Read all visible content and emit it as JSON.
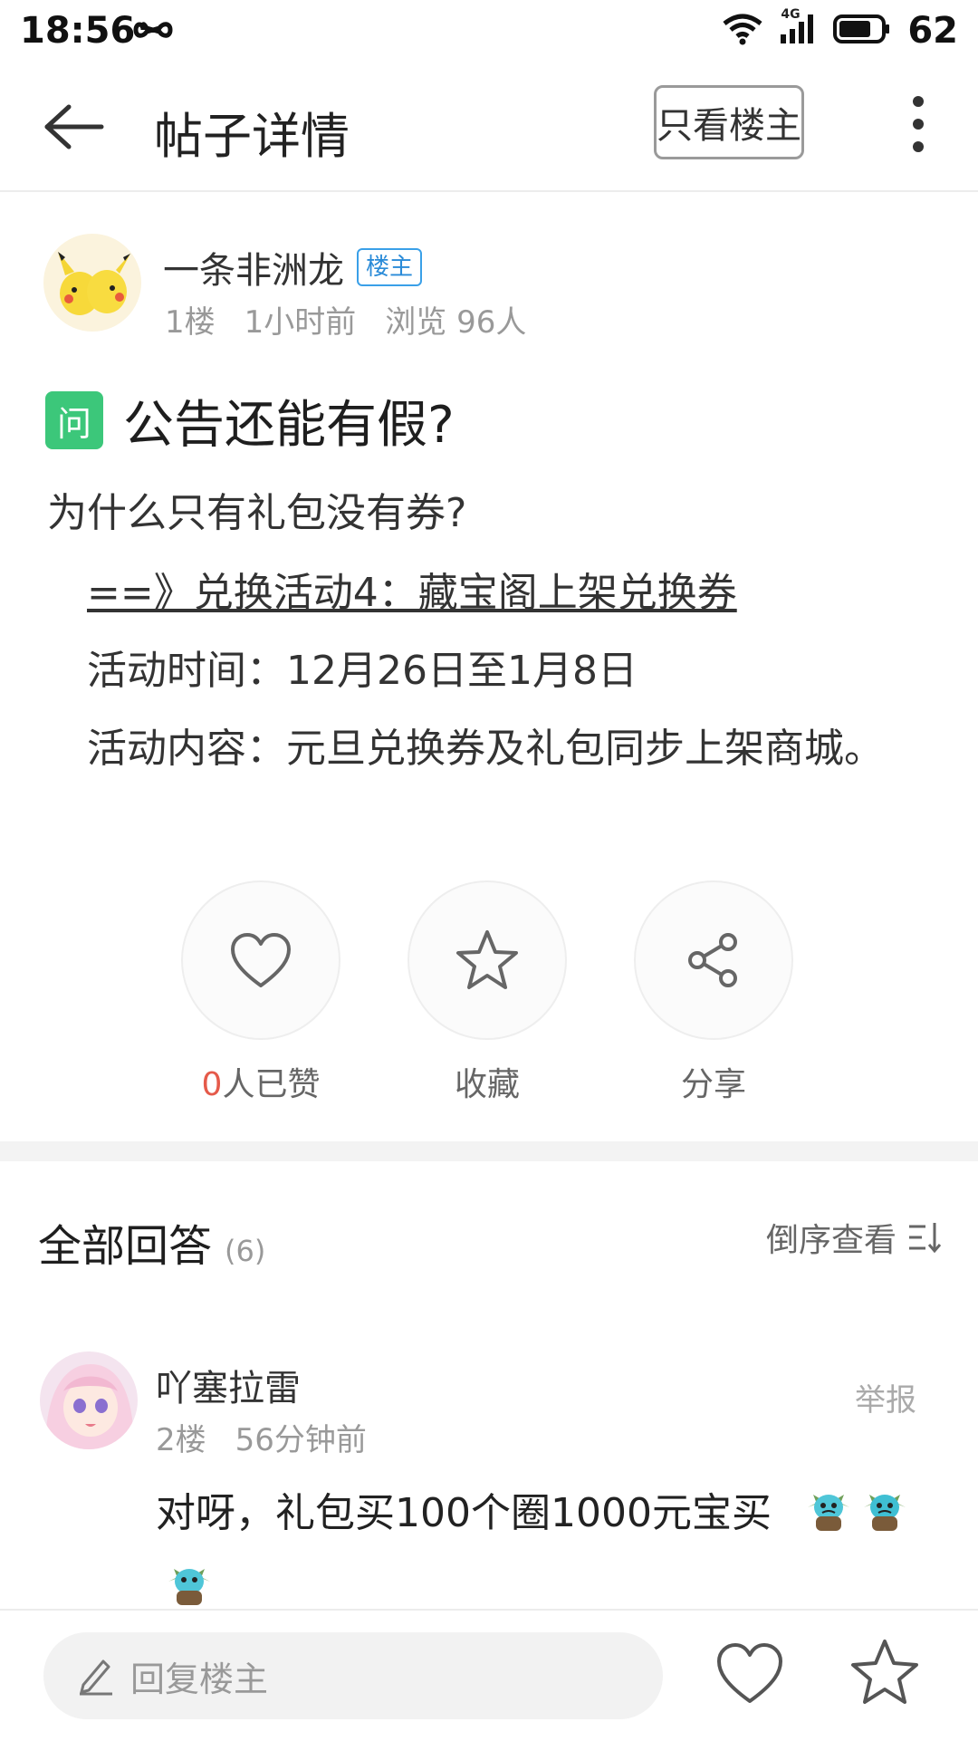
{
  "status_bar": {
    "time": "18:56",
    "battery": "62",
    "network": "4G"
  },
  "header": {
    "title": "帖子详情",
    "op_only_label": "只看楼主"
  },
  "post": {
    "author": "一条非洲龙",
    "op_badge": "楼主",
    "floor": "1楼",
    "time_ago": "1小时前",
    "views": "浏览 96人",
    "tag": "问",
    "title": "公告还能有假?",
    "body_line": "为什么只有礼包没有券?",
    "link_text": "==》兑换活动4：藏宝阁上架兑换券",
    "activity_time": "活动时间：12月26日至1月8日",
    "activity_content": "活动内容：元旦兑换券及礼包同步上架商城。"
  },
  "actions": {
    "like_count": "0",
    "like_suffix": "人已赞",
    "collect_label": "收藏",
    "share_label": "分享"
  },
  "answers": {
    "title": "全部回答",
    "count": "(6)",
    "sort_label": "倒序查看",
    "items": [
      {
        "author": "吖塞拉雷",
        "floor": "2楼",
        "time_ago": "56分钟前",
        "report_label": "举报",
        "text": "对呀，礼包买100个圈1000元宝买"
      }
    ]
  },
  "bottom_bar": {
    "reply_placeholder": "回复楼主"
  },
  "colors": {
    "accent_blue": "#2a8bd8",
    "tag_green": "#3cc77a",
    "like_red": "#e55a4a"
  },
  "icons": [
    "back-arrow-icon",
    "more-vertical-icon",
    "heart-icon",
    "star-icon",
    "share-icon",
    "sort-icon",
    "pencil-icon",
    "infinity-icon",
    "wifi-icon",
    "signal-icon",
    "battery-icon"
  ]
}
